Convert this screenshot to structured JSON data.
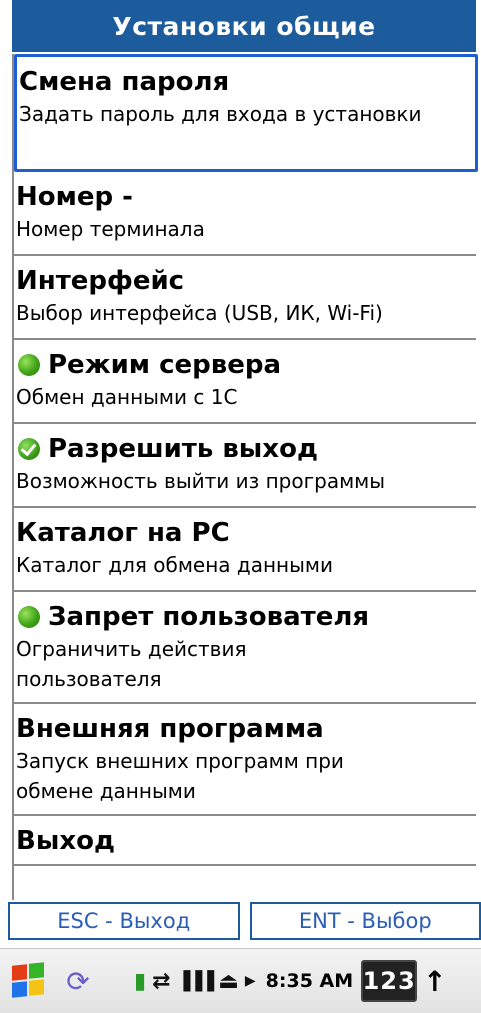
{
  "header": {
    "title": "Установки общие"
  },
  "menu": [
    {
      "title": "Смена пароля",
      "desc": "Задать пароль для входа в установки",
      "icon": "",
      "selected": true
    },
    {
      "title": "Номер -",
      "desc": "Номер терминала",
      "icon": ""
    },
    {
      "title": "Интерфейс",
      "desc": "Выбор интерфейса (USB, ИК, Wi-Fi)",
      "icon": ""
    },
    {
      "title": "Режим сервера",
      "desc": "Обмен данными с 1С",
      "icon": "green-dot-icon"
    },
    {
      "title": "Разрешить выход",
      "desc": "Возможность выйти из программы",
      "icon": "green-check-icon"
    },
    {
      "title": "Каталог на PC",
      "desc": "Каталог для обмена данными",
      "icon": ""
    },
    {
      "title": "Запрет пользователя",
      "desc": "Ограничить действия пользователя",
      "icon": "green-dot-icon"
    },
    {
      "title": "Внешняя программа",
      "desc": "Запуск внешних программ при обмене данными",
      "icon": ""
    },
    {
      "title": "Выход",
      "desc": "",
      "icon": ""
    }
  ],
  "footer": {
    "esc_label": "ESC - Выход",
    "ent_label": "ENT - Выбор"
  },
  "taskbar": {
    "time": "8:35 AM",
    "keyboard_label": "123"
  },
  "colors": {
    "header_bg": "#1c5c9c",
    "selection_border": "#1e5fd0",
    "footer_text": "#2a5db5"
  }
}
